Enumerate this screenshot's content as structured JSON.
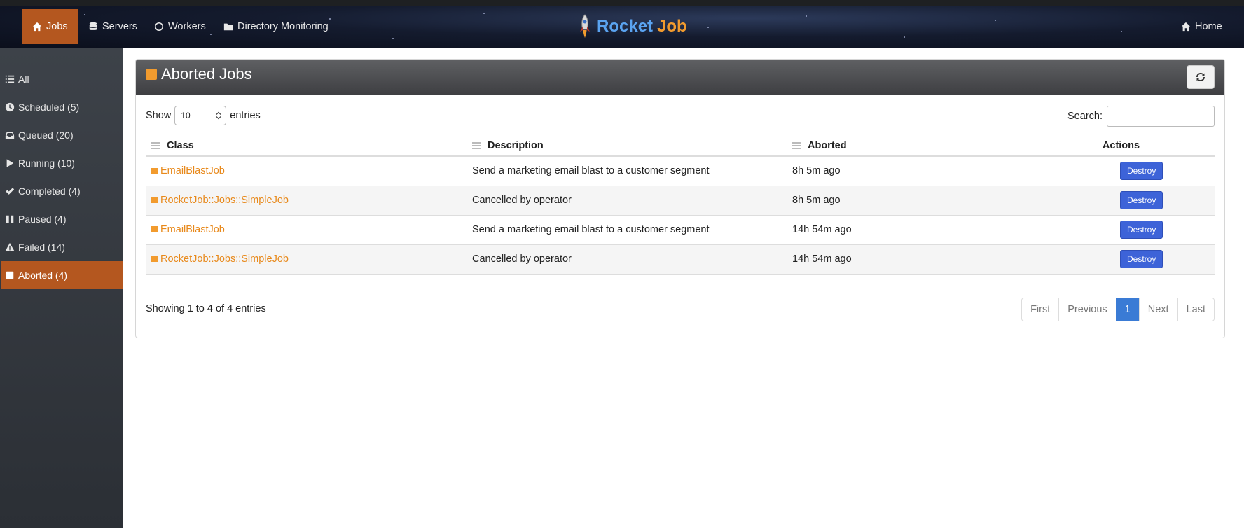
{
  "nav": {
    "items": [
      {
        "label": "Jobs",
        "icon": "home-icon",
        "active": true
      },
      {
        "label": "Servers",
        "icon": "database-icon",
        "active": false
      },
      {
        "label": "Workers",
        "icon": "circle-icon",
        "active": false
      },
      {
        "label": "Directory Monitoring",
        "icon": "folder-icon",
        "active": false
      }
    ],
    "brand_part1": "Rocket",
    "brand_part2": "Job",
    "home_label": "Home"
  },
  "sidebar": {
    "items": [
      {
        "label": "All",
        "icon": "list-icon"
      },
      {
        "label": "Scheduled (5)",
        "icon": "clock-icon"
      },
      {
        "label": "Queued (20)",
        "icon": "inbox-icon"
      },
      {
        "label": "Running (10)",
        "icon": "play-icon"
      },
      {
        "label": "Completed (4)",
        "icon": "check-icon"
      },
      {
        "label": "Paused (4)",
        "icon": "pause-icon"
      },
      {
        "label": "Failed (14)",
        "icon": "warning-icon"
      },
      {
        "label": "Aborted (4)",
        "icon": "stop-icon"
      }
    ],
    "active_index": 7
  },
  "panel": {
    "title": "Aborted Jobs",
    "show_label": "Show",
    "page_size": "10",
    "entries_label": "entries",
    "search_label": "Search:",
    "search_value": ""
  },
  "table": {
    "headers": [
      "Class",
      "Description",
      "Aborted",
      "Actions"
    ],
    "rows": [
      {
        "class": "EmailBlastJob",
        "description": "Send a marketing email blast to a customer segment",
        "aborted": "8h 5m ago",
        "action": "Destroy"
      },
      {
        "class": "RocketJob::Jobs::SimpleJob",
        "description": "Cancelled by operator",
        "aborted": "8h 5m ago",
        "action": "Destroy"
      },
      {
        "class": "EmailBlastJob",
        "description": "Send a marketing email blast to a customer segment",
        "aborted": "14h 54m ago",
        "action": "Destroy"
      },
      {
        "class": "RocketJob::Jobs::SimpleJob",
        "description": "Cancelled by operator",
        "aborted": "14h 54m ago",
        "action": "Destroy"
      }
    ]
  },
  "footer": {
    "info": "Showing 1 to 4 of 4 entries",
    "pager": {
      "first": "First",
      "previous": "Previous",
      "current": "1",
      "next": "Next",
      "last": "Last"
    }
  },
  "colors": {
    "accent": "#b4571f",
    "orange": "#f29b2e",
    "button_blue": "#3d63d8",
    "pager_blue": "#3a7bd5"
  }
}
